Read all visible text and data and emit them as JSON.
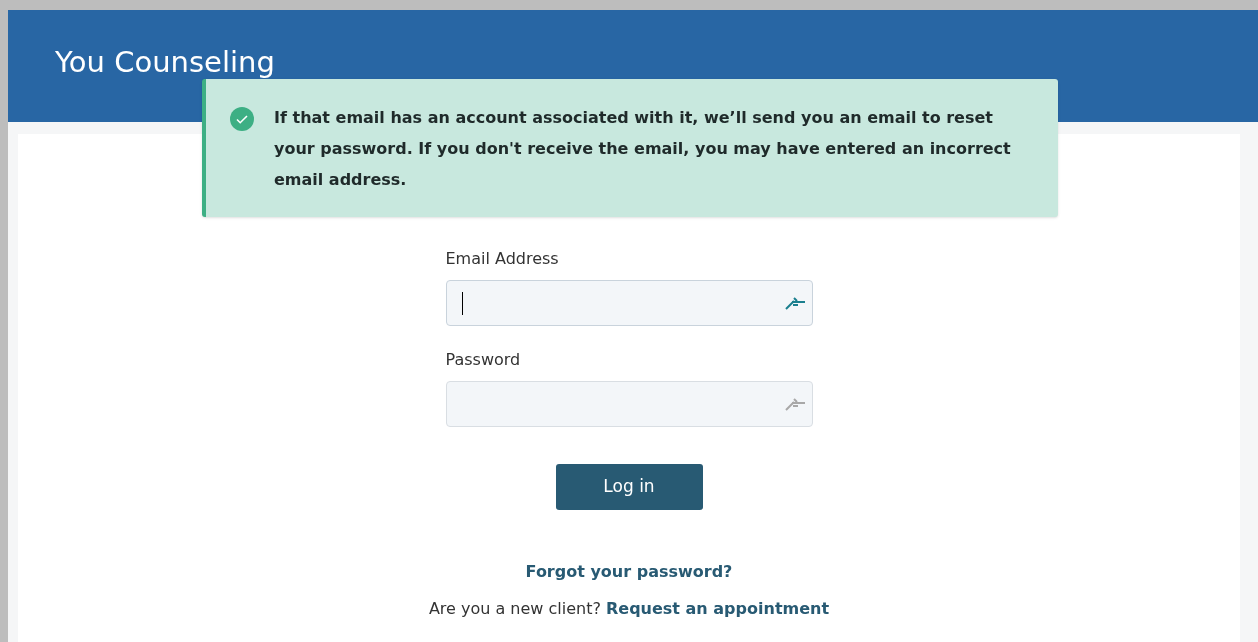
{
  "header": {
    "title": "You Counseling"
  },
  "alert": {
    "message": "If that email has an account associated with it, we’ll send you an email to reset your password. If you don't receive the email, you may have entered an incorrect email address."
  },
  "fields": [
    {
      "label": "Email Address",
      "focused": true
    },
    {
      "label": "Password",
      "focused": false
    }
  ],
  "login_button": "Log in",
  "forgot_link": "Forgot your password?",
  "new_client": {
    "question": "Are you a new client?",
    "link": "Request an appointment"
  }
}
